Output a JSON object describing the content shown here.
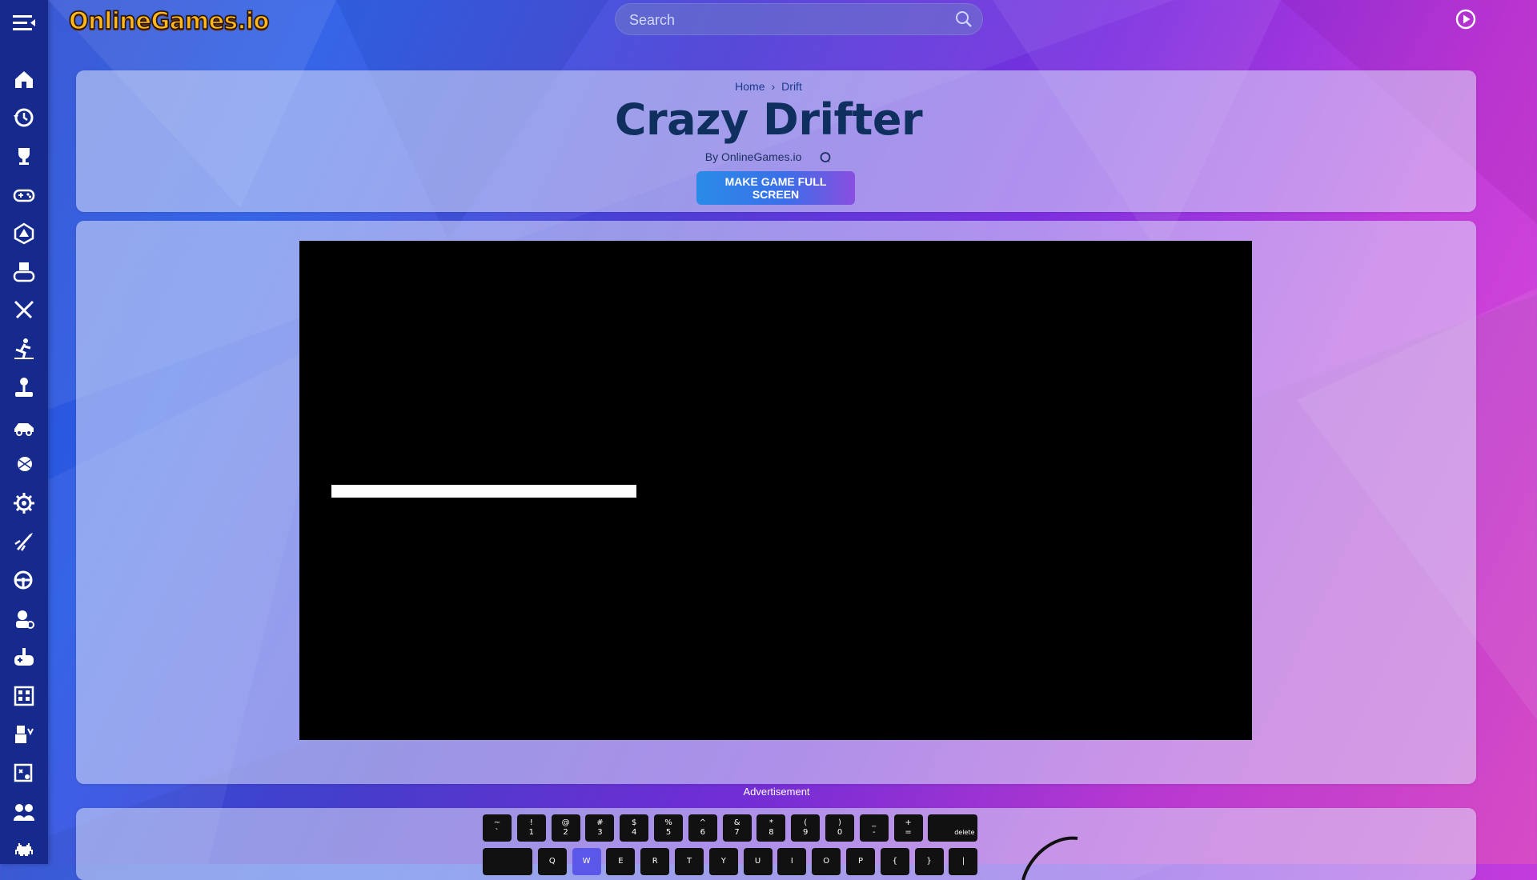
{
  "header": {
    "logo_text": "OnlineGames.io",
    "search_placeholder": "Search"
  },
  "sidebar": {
    "items": [
      {
        "icon": "home-icon"
      },
      {
        "icon": "history-icon"
      },
      {
        "icon": "trophy-icon"
      },
      {
        "icon": "gamepad-icon"
      },
      {
        "icon": "dice-icon"
      },
      {
        "icon": "puzzle-controller-icon"
      },
      {
        "icon": "swords-icon"
      },
      {
        "icon": "runner-icon"
      },
      {
        "icon": "joystick-icon"
      },
      {
        "icon": "racing-car-icon"
      },
      {
        "icon": "sports-ball-icon"
      },
      {
        "icon": "gear-icon"
      },
      {
        "icon": "rocket-icon"
      },
      {
        "icon": "steering-wheel-icon"
      },
      {
        "icon": "driver-icon"
      },
      {
        "icon": "controller-plus-icon"
      },
      {
        "icon": "building-icon"
      },
      {
        "icon": "shooter-icon"
      },
      {
        "icon": "puzzle-icon"
      },
      {
        "icon": "two-players-icon"
      },
      {
        "icon": "space-invader-icon"
      }
    ]
  },
  "page": {
    "breadcrumb": [
      "Home",
      "Drift"
    ],
    "breadcrumb_separator": "›",
    "title": "Crazy Drifter",
    "byline": "By OnlineGames.io",
    "fullscreen_button": "MAKE GAME FULL SCREEN",
    "advertisement_label": "Advertisement"
  },
  "game": {
    "loading_progress": 0.32
  },
  "keyboard": {
    "row1": [
      {
        "top": "~",
        "bottom": "`"
      },
      {
        "top": "!",
        "bottom": "1"
      },
      {
        "top": "@",
        "bottom": "2"
      },
      {
        "top": "#",
        "bottom": "3"
      },
      {
        "top": "$",
        "bottom": "4"
      },
      {
        "top": "%",
        "bottom": "5"
      },
      {
        "top": "^",
        "bottom": "6"
      },
      {
        "top": "&",
        "bottom": "7"
      },
      {
        "top": "*",
        "bottom": "8"
      },
      {
        "top": "(",
        "bottom": "9"
      },
      {
        "top": ")",
        "bottom": "0"
      },
      {
        "top": "_",
        "bottom": "-"
      },
      {
        "top": "+",
        "bottom": "="
      },
      {
        "top": "",
        "bottom": "delete"
      }
    ],
    "row2": [
      "",
      "Q",
      "W",
      "E",
      "R",
      "T",
      "Y",
      "U",
      "I",
      "O",
      "P",
      "{",
      "}",
      "|"
    ],
    "active_key": "W"
  },
  "colors": {
    "sidebar": "#152a8c",
    "title": "#0f2f5e",
    "logo": "#ffb81c"
  }
}
